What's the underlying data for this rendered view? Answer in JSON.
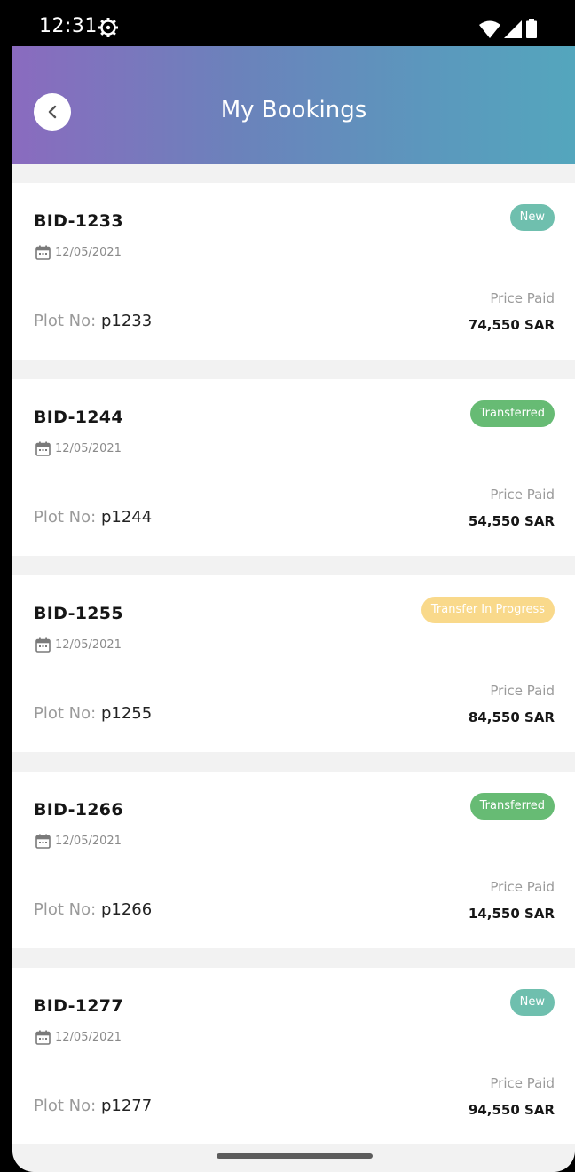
{
  "status_bar": {
    "time": "12:31"
  },
  "header": {
    "title": "My Bookings"
  },
  "bookings": [
    {
      "id": "BID-1233",
      "date": "12/05/2021",
      "plot_label": "Plot No:",
      "plot_value": "p1233",
      "status": "New",
      "price_label": "Price Paid",
      "price": "74,550 SAR"
    },
    {
      "id": "BID-1244",
      "date": "12/05/2021",
      "plot_label": "Plot No:",
      "plot_value": "p1244",
      "status": "Transferred",
      "price_label": "Price Paid",
      "price": "54,550 SAR"
    },
    {
      "id": "BID-1255",
      "date": "12/05/2021",
      "plot_label": "Plot No:",
      "plot_value": "p1255",
      "status": "Transfer In Progress",
      "price_label": "Price Paid",
      "price": "84,550 SAR"
    },
    {
      "id": "BID-1266",
      "date": "12/05/2021",
      "plot_label": "Plot No:",
      "plot_value": "p1266",
      "status": "Transferred",
      "price_label": "Price Paid",
      "price": "14,550 SAR"
    },
    {
      "id": "BID-1277",
      "date": "12/05/2021",
      "plot_label": "Plot No:",
      "plot_value": "p1277",
      "status": "New",
      "price_label": "Price Paid",
      "price": "94,550 SAR"
    }
  ],
  "status_colors": {
    "New": "#6fbfae",
    "Transferred": "#67bb74",
    "Transfer In Progress": "#f9d98b"
  },
  "icons": {
    "back": "chevron-left-icon",
    "date": "calendar-icon",
    "settings": "gear-icon",
    "wifi": "wifi-icon",
    "signal": "signal-icon",
    "battery": "battery-icon"
  }
}
